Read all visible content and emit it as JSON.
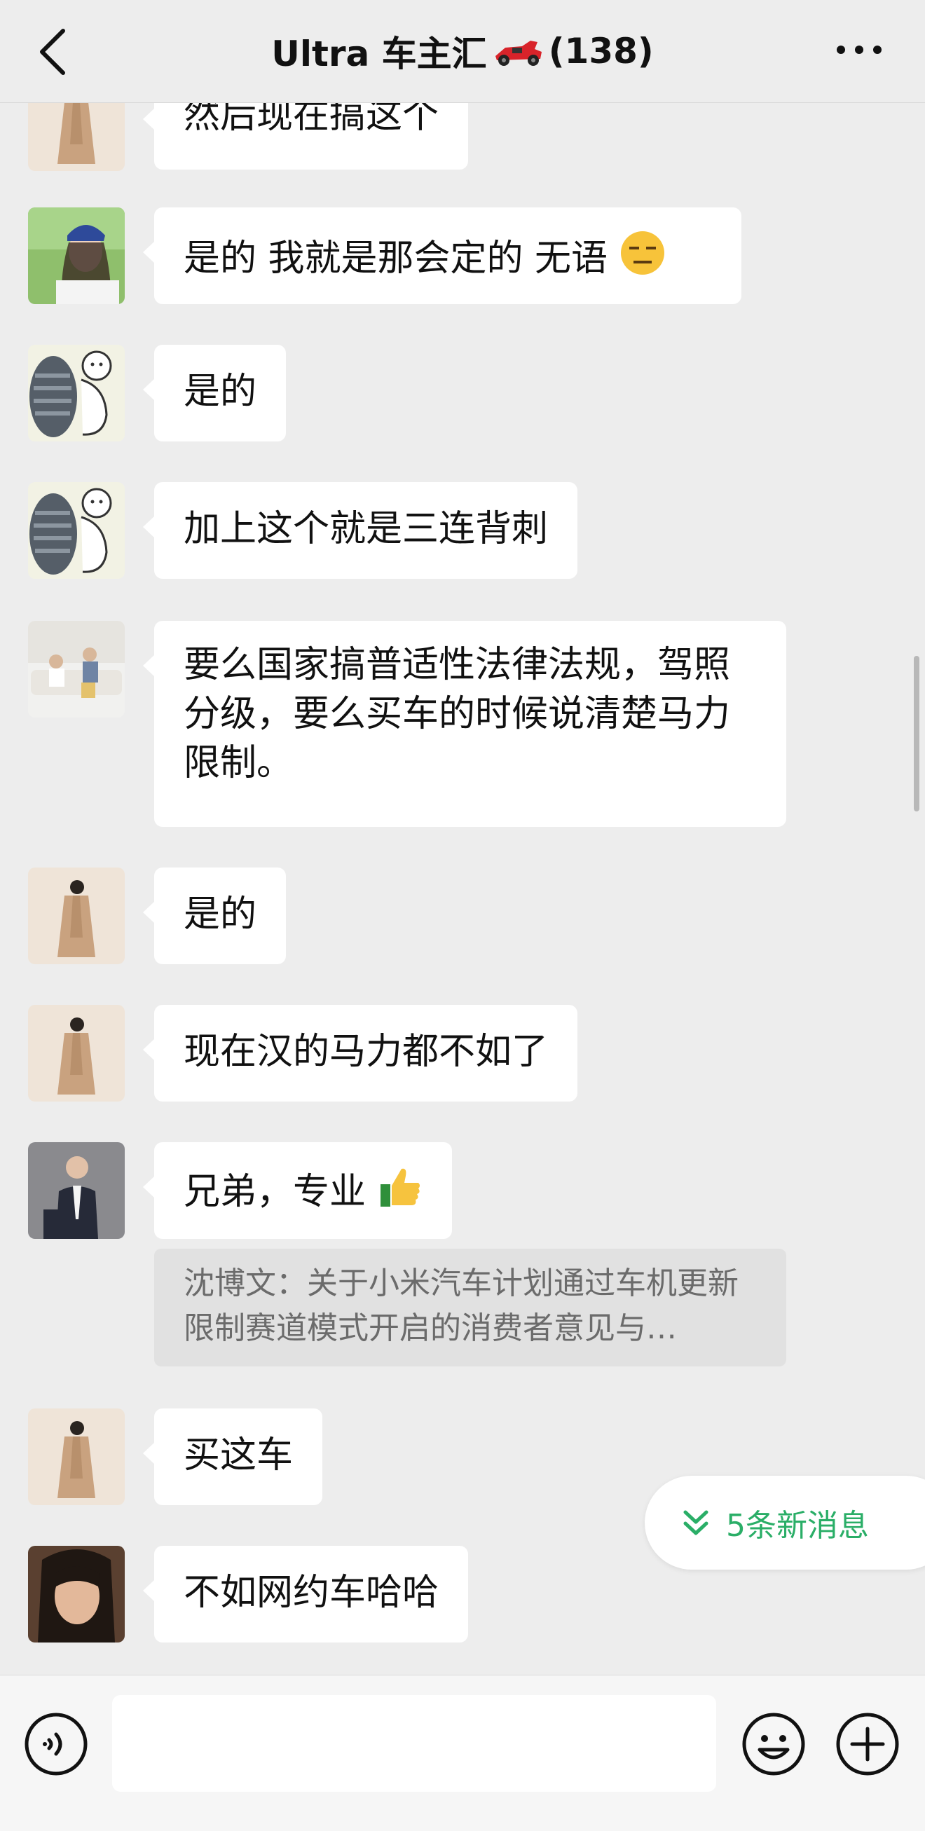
{
  "header": {
    "title": "Ultra 车主汇",
    "member_count": "(138)"
  },
  "messages": [
    {
      "text": "然后现在搞这个",
      "avatar": "coat-figure"
    },
    {
      "text": "是的 我就是那会定的 无语",
      "avatar": "girl-blue-cap",
      "emoji": "expressionless-face"
    },
    {
      "text": "是的",
      "avatar": "cartoon-bear"
    },
    {
      "text": "加上这个就是三连背刺",
      "avatar": "cartoon-bear"
    },
    {
      "text": "要么国家搞普适性法律法规，驾照分级，要么买车的时候说清楚马力限制。",
      "avatar": "living-room-photo"
    },
    {
      "text": "是的",
      "avatar": "coat-figure"
    },
    {
      "text": "现在汉的马力都不如了",
      "avatar": "coat-figure"
    },
    {
      "text": "兄弟，专业",
      "avatar": "man-suit",
      "emoji": "thumbs-up"
    },
    {
      "text": "买这车",
      "avatar": "coat-figure"
    },
    {
      "text": "不如网约车哈哈",
      "avatar": "long-hair-man"
    }
  ],
  "quote": {
    "text": "沈博文：关于小米汽车计划通过车机更新限制赛道模式开启的消费者意见与…"
  },
  "new_messages_label": "5条新消息",
  "colors": {
    "background": "#ededed",
    "bubble": "#ffffff",
    "accent_green": "#2aae67",
    "quote_bg": "#e1e1e1"
  },
  "icons": [
    "back-icon",
    "more-icon",
    "race-car-icon",
    "voice-icon",
    "emoji-icon",
    "plus-icon",
    "double-chevron-down-icon"
  ]
}
